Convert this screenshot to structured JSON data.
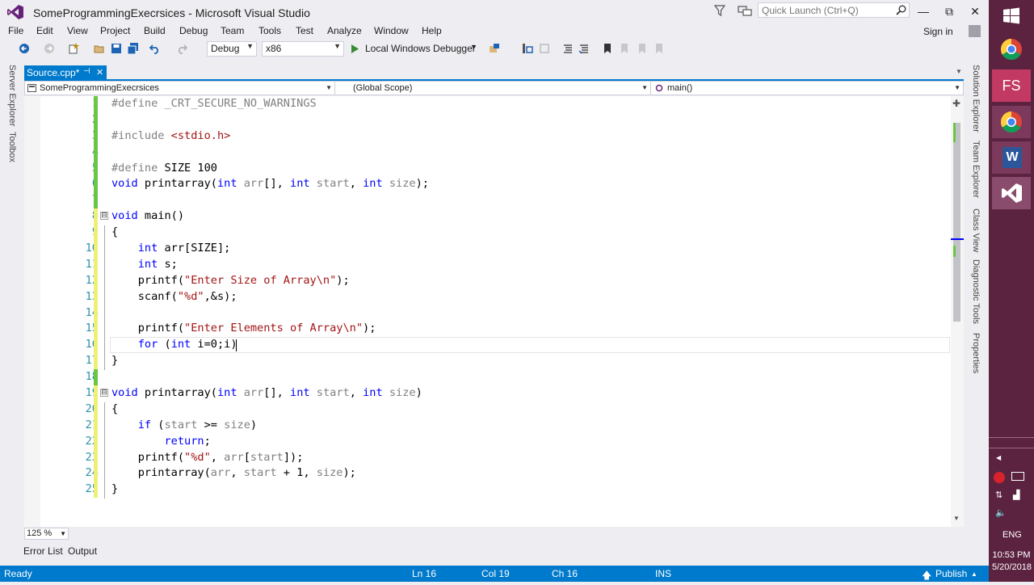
{
  "window": {
    "title": "SomeProgrammingExecrsices - Microsoft Visual Studio",
    "quick_launch_placeholder": "Quick Launch (Ctrl+Q)",
    "min_label": "—",
    "restore_label": "⧉",
    "close_label": "✕"
  },
  "menu": {
    "items": [
      "File",
      "Edit",
      "View",
      "Project",
      "Build",
      "Debug",
      "Team",
      "Tools",
      "Test",
      "Analyze",
      "Window",
      "Help"
    ],
    "sign_in": "Sign in"
  },
  "toolbar": {
    "config": "Debug",
    "platform": "x86",
    "debugger": "Local Windows Debugger"
  },
  "side_tabs": {
    "left": [
      "Server Explorer",
      "Toolbox"
    ],
    "right": [
      "Solution Explorer",
      "Team Explorer",
      "Class View",
      "Diagnostic Tools",
      "Properties"
    ]
  },
  "document": {
    "tab_label": "Source.cpp*",
    "pin_glyph": "⊣",
    "close_glyph": "✕"
  },
  "navbar": {
    "project": "SomeProgrammingExecrsices",
    "scope": "(Global Scope)",
    "member": "main()"
  },
  "editor": {
    "lines": [
      {
        "n": "1",
        "tokens": [
          {
            "t": "#define",
            "c": "pp"
          },
          {
            "t": " _CRT_SECURE_NO_WARNINGS",
            "c": "ptxt"
          }
        ]
      },
      {
        "n": "2",
        "tokens": []
      },
      {
        "n": "3",
        "tokens": [
          {
            "t": "#include",
            "c": "pp"
          },
          {
            "t": " <stdio.h>",
            "c": "str"
          }
        ]
      },
      {
        "n": "4",
        "tokens": []
      },
      {
        "n": "5",
        "tokens": [
          {
            "t": "#define",
            "c": "pp"
          },
          {
            "t": " SIZE 100",
            "c": ""
          }
        ]
      },
      {
        "n": "6",
        "tokens": [
          {
            "t": "void",
            "c": "kw"
          },
          {
            "t": " printarray(",
            "c": ""
          },
          {
            "t": "int",
            "c": "kw"
          },
          {
            "t": " ",
            "c": ""
          },
          {
            "t": "arr",
            "c": "ptxt"
          },
          {
            "t": "[], ",
            "c": ""
          },
          {
            "t": "int",
            "c": "kw"
          },
          {
            "t": " ",
            "c": ""
          },
          {
            "t": "start",
            "c": "ptxt"
          },
          {
            "t": ", ",
            "c": ""
          },
          {
            "t": "int",
            "c": "kw"
          },
          {
            "t": " ",
            "c": ""
          },
          {
            "t": "size",
            "c": "ptxt"
          },
          {
            "t": ");",
            "c": ""
          }
        ]
      },
      {
        "n": "7",
        "tokens": []
      },
      {
        "n": "8",
        "fold": "⊟",
        "tokens": [
          {
            "t": "void",
            "c": "kw"
          },
          {
            "t": " main()",
            "c": ""
          }
        ]
      },
      {
        "n": "9",
        "tokens": [
          {
            "t": "{",
            "c": ""
          }
        ]
      },
      {
        "n": "10",
        "tokens": [
          {
            "t": "    ",
            "c": ""
          },
          {
            "t": "int",
            "c": "kw"
          },
          {
            "t": " arr[SIZE];",
            "c": ""
          }
        ]
      },
      {
        "n": "11",
        "tokens": [
          {
            "t": "    ",
            "c": ""
          },
          {
            "t": "int",
            "c": "kw"
          },
          {
            "t": " s;",
            "c": ""
          }
        ]
      },
      {
        "n": "12",
        "tokens": [
          {
            "t": "    printf(",
            "c": ""
          },
          {
            "t": "\"Enter Size of Array\\n\"",
            "c": "str"
          },
          {
            "t": ");",
            "c": ""
          }
        ]
      },
      {
        "n": "13",
        "tokens": [
          {
            "t": "    scanf(",
            "c": ""
          },
          {
            "t": "\"%d\"",
            "c": "str"
          },
          {
            "t": ",&s);",
            "c": ""
          }
        ]
      },
      {
        "n": "14",
        "tokens": []
      },
      {
        "n": "15",
        "tokens": [
          {
            "t": "    printf(",
            "c": ""
          },
          {
            "t": "\"Enter Elements of Array\\n\"",
            "c": "str"
          },
          {
            "t": ");",
            "c": ""
          }
        ]
      },
      {
        "n": "16",
        "tokens": [
          {
            "t": "    ",
            "c": ""
          },
          {
            "t": "for",
            "c": "kw"
          },
          {
            "t": " (",
            "c": ""
          },
          {
            "t": "int",
            "c": "kw"
          },
          {
            "t": " i=0;i)",
            "c": ""
          }
        ]
      },
      {
        "n": "17",
        "tokens": [
          {
            "t": "}",
            "c": ""
          }
        ]
      },
      {
        "n": "18",
        "tokens": []
      },
      {
        "n": "19",
        "fold": "⊟",
        "tokens": [
          {
            "t": "void",
            "c": "kw"
          },
          {
            "t": " printarray(",
            "c": ""
          },
          {
            "t": "int",
            "c": "kw"
          },
          {
            "t": " ",
            "c": ""
          },
          {
            "t": "arr",
            "c": "ptxt"
          },
          {
            "t": "[], ",
            "c": ""
          },
          {
            "t": "int",
            "c": "kw"
          },
          {
            "t": " ",
            "c": ""
          },
          {
            "t": "start",
            "c": "ptxt"
          },
          {
            "t": ", ",
            "c": ""
          },
          {
            "t": "int",
            "c": "kw"
          },
          {
            "t": " ",
            "c": ""
          },
          {
            "t": "size",
            "c": "ptxt"
          },
          {
            "t": ")",
            "c": ""
          }
        ]
      },
      {
        "n": "20",
        "tokens": [
          {
            "t": "{",
            "c": ""
          }
        ]
      },
      {
        "n": "21",
        "tokens": [
          {
            "t": "    ",
            "c": ""
          },
          {
            "t": "if",
            "c": "kw"
          },
          {
            "t": " (",
            "c": ""
          },
          {
            "t": "start",
            "c": "ptxt"
          },
          {
            "t": " >= ",
            "c": ""
          },
          {
            "t": "size",
            "c": "ptxt"
          },
          {
            "t": ")",
            "c": ""
          }
        ]
      },
      {
        "n": "22",
        "tokens": [
          {
            "t": "        ",
            "c": ""
          },
          {
            "t": "return",
            "c": "kw"
          },
          {
            "t": ";",
            "c": ""
          }
        ]
      },
      {
        "n": "23",
        "tokens": [
          {
            "t": "    printf(",
            "c": ""
          },
          {
            "t": "\"%d\"",
            "c": "str"
          },
          {
            "t": ", ",
            "c": ""
          },
          {
            "t": "arr",
            "c": "ptxt"
          },
          {
            "t": "[",
            "c": ""
          },
          {
            "t": "start",
            "c": "ptxt"
          },
          {
            "t": "]);",
            "c": ""
          }
        ]
      },
      {
        "n": "24",
        "tokens": [
          {
            "t": "    printarray(",
            "c": ""
          },
          {
            "t": "arr",
            "c": "ptxt"
          },
          {
            "t": ", ",
            "c": ""
          },
          {
            "t": "start",
            "c": "ptxt"
          },
          {
            "t": " + 1, ",
            "c": ""
          },
          {
            "t": "size",
            "c": "ptxt"
          },
          {
            "t": ");",
            "c": ""
          }
        ]
      },
      {
        "n": "25",
        "tokens": [
          {
            "t": "}",
            "c": ""
          }
        ]
      }
    ],
    "saved_color": "#6cc644",
    "unsaved_color": "#efef78"
  },
  "zoom": "125 %",
  "bottom_tabs": [
    "Error List",
    "Output"
  ],
  "status": {
    "state": "Ready",
    "ln": "Ln 16",
    "col": "Col 19",
    "ch": "Ch 16",
    "mode": "INS",
    "publish": "Publish"
  },
  "taskbar": {
    "apps": [
      "start-icon",
      "chrome-icon",
      "fs-app-icon",
      "chrome-icon",
      "word-icon",
      "visual-studio-icon"
    ],
    "fs_label": "FS",
    "word_label": "W",
    "lang": "ENG",
    "time": "10:53 PM",
    "date": "5/20/2018"
  },
  "colors": {
    "accent": "#007acc",
    "taskbar": "#5c2340",
    "keyword": "#0000ff",
    "string": "#a31515",
    "line_number": "#2b91af"
  }
}
